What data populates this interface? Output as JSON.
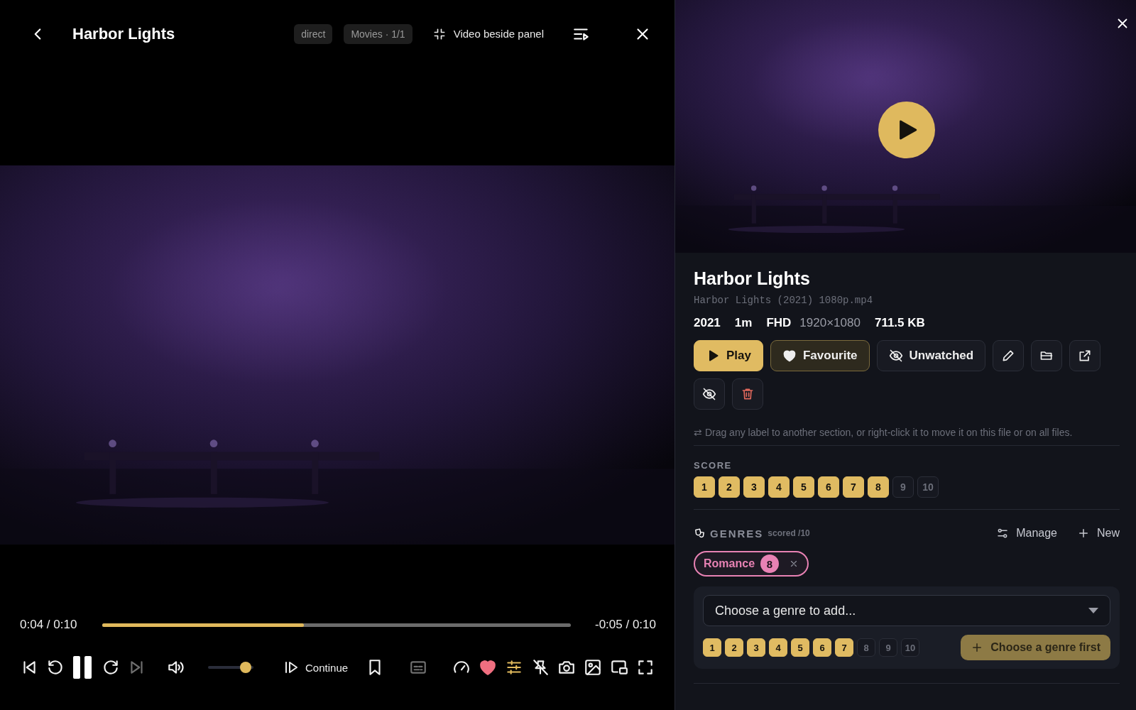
{
  "player": {
    "title": "Harbor Lights",
    "badges": [
      "direct",
      "Movies · 1/1"
    ],
    "layout_button": "Video beside panel",
    "video": {
      "kind": "picture"
    },
    "elapsed": "0:04 / 0:10",
    "remaining": "-0:05 / 0:10",
    "progress": {
      "level": 0.43
    },
    "volume": {
      "level": 0.95
    },
    "continue_button": "Continue",
    "playing": true,
    "next_disabled": true,
    "subtitles_disabled": true,
    "favourite": true,
    "equalizer_on": true
  },
  "panel": {
    "thumbnail": {
      "kind": "picture"
    },
    "title": "Harbor Lights",
    "file_name": "Harbor Lights (2021) 1080p.mp4",
    "meta": [
      {
        "text": "2021",
        "kind": "strong"
      },
      {
        "text": "1m",
        "kind": "strong"
      },
      {
        "text": "FHD",
        "kind": "strong"
      },
      {
        "text": "1920×1080",
        "kind": "dim"
      },
      {
        "text": "711.5 KB",
        "kind": "strong"
      }
    ],
    "actions": [
      {
        "label": "Play",
        "kind": "primary"
      },
      {
        "label": "Favourite",
        "kind": "favourite"
      },
      {
        "label": "Unwatched",
        "kind": "plain"
      }
    ],
    "hint": "⇄ Drag any label to another section, or right-click it to move it on this file or on all files.",
    "score": {
      "heading": "SCORE",
      "options": [
        {
          "label": "1",
          "selected": true
        },
        {
          "label": "2",
          "selected": true
        },
        {
          "label": "3",
          "selected": true
        },
        {
          "label": "4",
          "selected": true
        },
        {
          "label": "5",
          "selected": true
        },
        {
          "label": "6",
          "selected": true
        },
        {
          "label": "7",
          "selected": true
        },
        {
          "label": "8",
          "selected": true
        },
        {
          "label": "9",
          "selected": false
        },
        {
          "label": "10",
          "selected": false
        }
      ]
    },
    "genres": {
      "heading": "GENRES",
      "subheading": "scored /10",
      "manage_button": "Manage",
      "new_button": "New",
      "chips": [
        {
          "label": "Romance",
          "score": "8",
          "color": "#e882b4"
        }
      ],
      "select": {
        "placeholder": "Choose a genre to add..."
      },
      "score_options": [
        {
          "label": "1",
          "selected": true
        },
        {
          "label": "2",
          "selected": true
        },
        {
          "label": "3",
          "selected": true
        },
        {
          "label": "4",
          "selected": true
        },
        {
          "label": "5",
          "selected": true
        },
        {
          "label": "6",
          "selected": true
        },
        {
          "label": "7",
          "selected": true
        },
        {
          "label": "8",
          "selected": false
        },
        {
          "label": "9",
          "selected": false
        },
        {
          "label": "10",
          "selected": false
        }
      ],
      "add_button": {
        "label": "Choose a genre first",
        "disabled": true
      }
    }
  }
}
